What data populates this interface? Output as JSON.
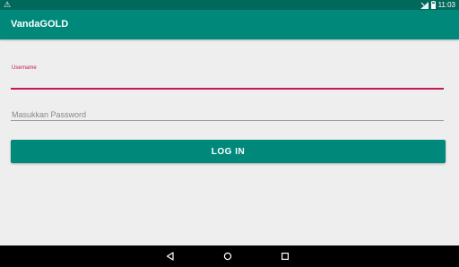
{
  "status_bar": {
    "warning_glyph": "⚠",
    "time": "11:03",
    "icons": [
      "warning-icon",
      "signal-icon",
      "battery-icon"
    ]
  },
  "app_bar": {
    "title": "VandaGOLD"
  },
  "login_form": {
    "username_label": "Username",
    "username_value": "",
    "password_placeholder": "Masukkan Password",
    "password_value": "",
    "login_button_label": "LOG IN"
  },
  "nav_bar": {
    "icons": [
      "back-icon",
      "home-icon",
      "recents-icon"
    ]
  },
  "colors": {
    "primary": "#00897b",
    "primary_dark": "#00695c",
    "accent": "#c2185b",
    "background": "#eeeeee"
  }
}
